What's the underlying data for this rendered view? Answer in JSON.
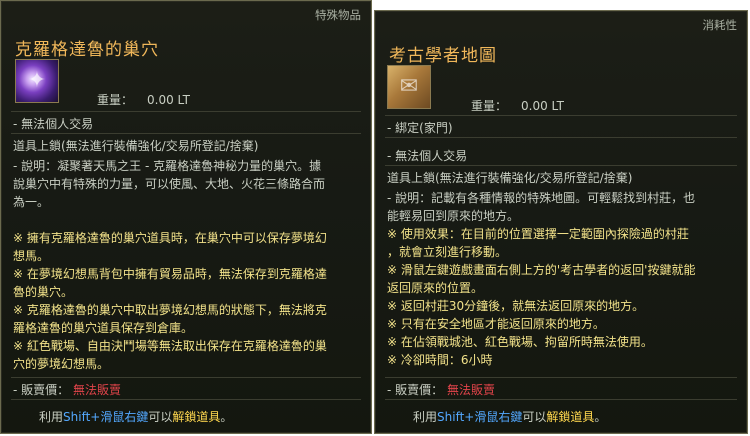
{
  "left_tooltip": {
    "category": "特殊物品",
    "title": "克羅格達魯的巢穴",
    "icon": "glowing-nest-icon",
    "weight_label": "重量：",
    "weight_value": "0.00 LT",
    "trade": "- 無法個人交易",
    "lock": "道具上鎖(無法進行裝備強化/交易所登記/捨棄)",
    "desc_line1": "- 說明：凝聚著天馬之王 - 克羅格達魯神秘力量的巢穴。據",
    "desc_line2": "說巢穴中有特殊的力量，可以使風、大地、火花三條路合而",
    "desc_line3": "為一。",
    "notes": [
      "※ 擁有克羅格達魯的巢穴道具時，在巢穴中可以保存夢境幻",
      "想馬。",
      "※ 在夢境幻想馬背包中擁有貿易品時，無法保存到克羅格達",
      "魯的巢穴。",
      "※ 克羅格達魯的巢穴中取出夢境幻想馬的狀態下，無法將克",
      "羅格達魯的巢穴道具保存到倉庫。",
      "※ 紅色戰場、自由決鬥場等無法取出保存在克羅格達魯的巢",
      "穴的夢境幻想馬。"
    ],
    "price_label": "- 販賣價：",
    "price_value": "無法販賣",
    "hint_prefix": "利用",
    "hint_key": "Shift+滑鼠右鍵",
    "hint_mid": "可以",
    "hint_action": "解鎖道具",
    "hint_end": "。"
  },
  "right_tooltip": {
    "category": "消耗性",
    "title": "考古學者地圖",
    "icon": "treasure-map-icon",
    "weight_label": "重量：",
    "weight_value": "0.00 LT",
    "bound": "- 綁定(家門)",
    "trade": "- 無法個人交易",
    "lock": "道具上鎖(無法進行裝備強化/交易所登記/捨棄)",
    "desc_line1": "- 說明：記載有各種情報的特殊地圖。可輕鬆找到村莊，也",
    "desc_line2": "能輕易回到原來的地方。",
    "use_line1": "※ 使用效果：在目前的位置選擇一定範圍內探險過的村莊",
    "use_line2": "，就會立刻進行移動。",
    "notes": [
      "※ 滑鼠左鍵遊戲畫面右側上方的'考古學者的返回'按鍵就能",
      "返回原來的位置。",
      "※ 返回村莊30分鐘後，就無法返回原來的地方。",
      "※ 只有在安全地區才能返回原來的地方。",
      "※ 在佔領戰城池、紅色戰場、拘留所時無法使用。",
      "※ 冷卻時間：6小時"
    ],
    "price_label": "- 販賣價：",
    "price_value": "無法販賣",
    "hint_prefix": "利用",
    "hint_key": "Shift+滑鼠右鍵",
    "hint_mid": "可以",
    "hint_action": "解鎖道具",
    "hint_end": "。"
  }
}
